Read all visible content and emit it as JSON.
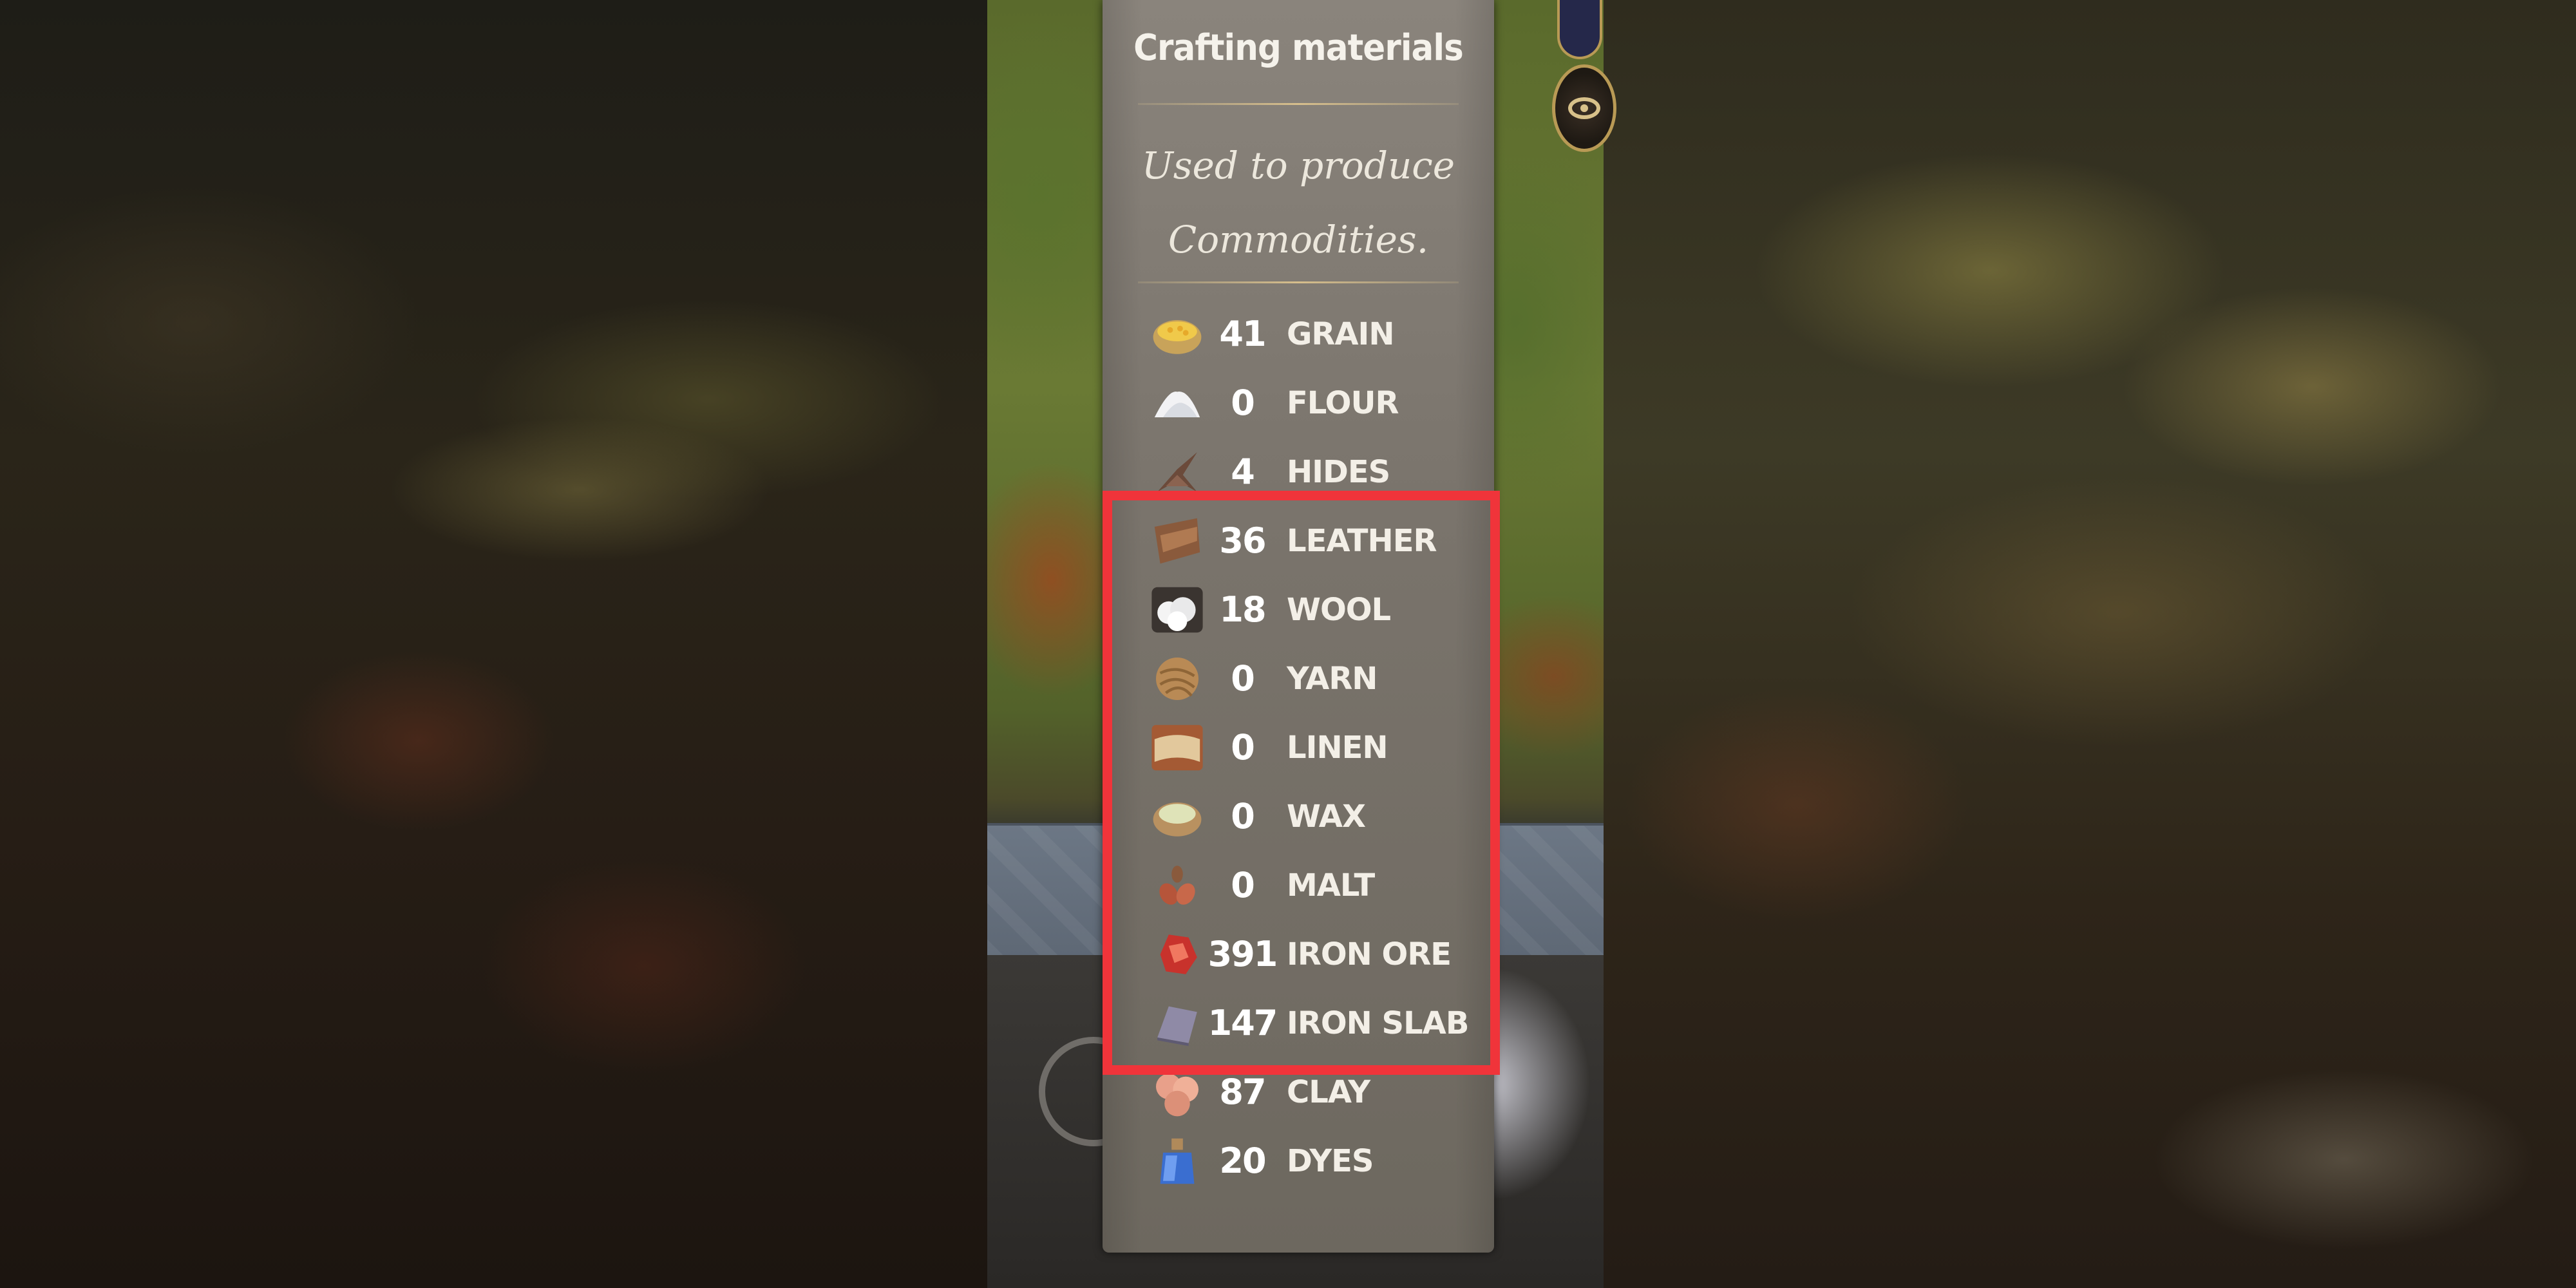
{
  "colors": {
    "highlight": "#f0343a",
    "panel": "#7a746c",
    "accent_gold": "#d6be8c"
  },
  "tooltip": {
    "title": "Crafting materials",
    "description_line1": "Used to produce",
    "description_line2": "Commodities."
  },
  "materials": [
    {
      "icon": "grain-bowl-icon",
      "count": "41",
      "name": "GRAIN"
    },
    {
      "icon": "flour-pile-icon",
      "count": "0",
      "name": "FLOUR"
    },
    {
      "icon": "hides-icon",
      "count": "4",
      "name": "HIDES"
    },
    {
      "icon": "leather-icon",
      "count": "36",
      "name": "LEATHER"
    },
    {
      "icon": "wool-icon",
      "count": "18",
      "name": "WOOL"
    },
    {
      "icon": "yarn-ball-icon",
      "count": "0",
      "name": "YARN"
    },
    {
      "icon": "linen-cloth-icon",
      "count": "0",
      "name": "LINEN"
    },
    {
      "icon": "wax-bowl-icon",
      "count": "0",
      "name": "WAX"
    },
    {
      "icon": "malt-grains-icon",
      "count": "0",
      "name": "MALT"
    },
    {
      "icon": "iron-ore-icon",
      "count": "391",
      "name": "IRON ORE"
    },
    {
      "icon": "iron-slab-icon",
      "count": "147",
      "name": "IRON SLAB"
    },
    {
      "icon": "clay-icon",
      "count": "87",
      "name": "CLAY"
    },
    {
      "icon": "dyes-bottle-icon",
      "count": "20",
      "name": "DYES"
    }
  ]
}
